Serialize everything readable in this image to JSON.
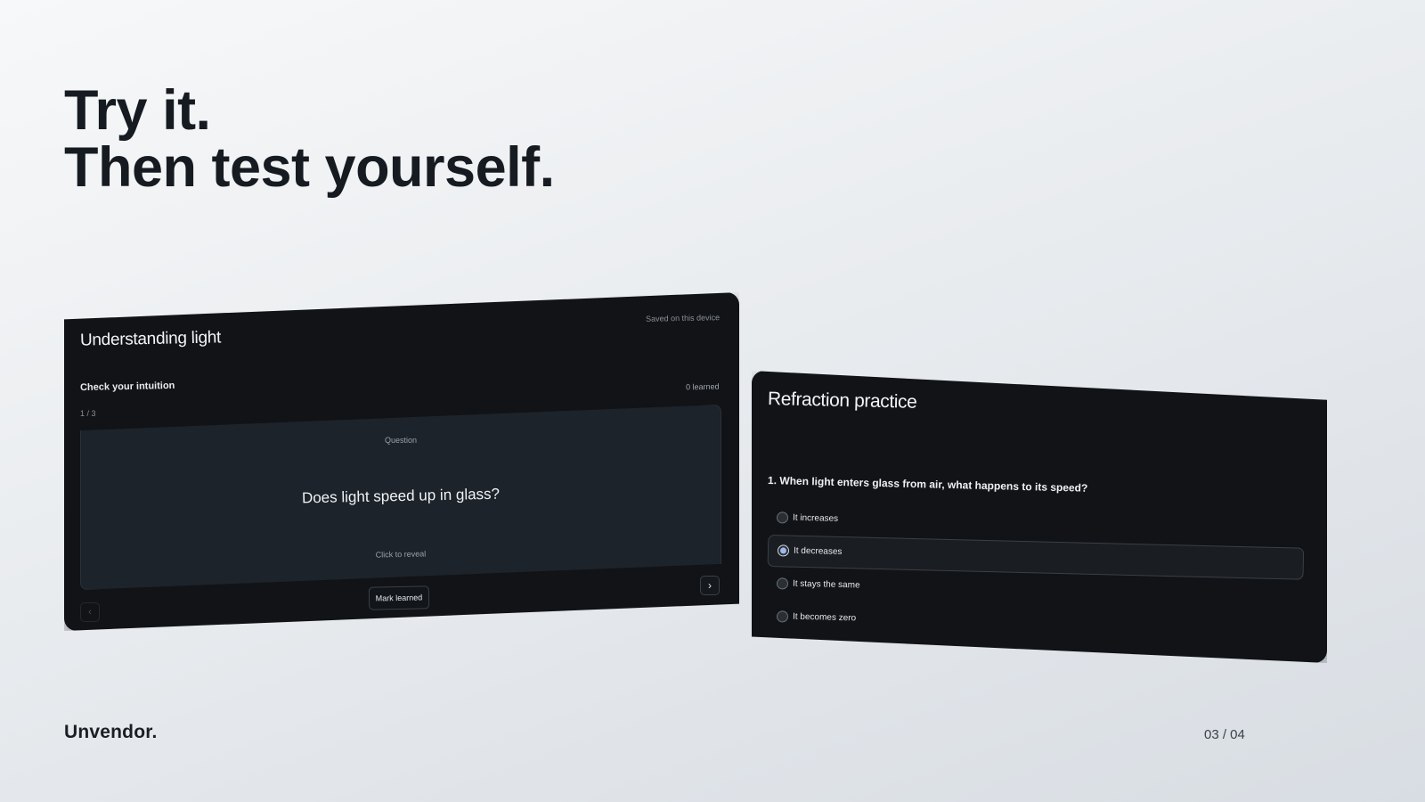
{
  "headline": {
    "line1": "Try it.",
    "line2": "Then test yourself."
  },
  "left_card": {
    "title": "Understanding light",
    "saved_status": "Saved on this device",
    "section_label": "Check your intuition",
    "learned_count": "0 learned",
    "position": "1 / 3",
    "flashcard": {
      "side_label": "Question",
      "text": "Does light speed up in glass?",
      "hint": "Click to reveal"
    },
    "mark_button": "Mark learned",
    "prev_icon": "chevron-left-icon",
    "next_icon": "chevron-right-icon"
  },
  "right_card": {
    "title": "Refraction practice",
    "question": "1. When light enters glass from air, what happens to its speed?",
    "options": [
      {
        "label": "It increases",
        "selected": false
      },
      {
        "label": "It decreases",
        "selected": true
      },
      {
        "label": "It stays the same",
        "selected": false
      },
      {
        "label": "It becomes zero",
        "selected": false
      }
    ]
  },
  "footer": {
    "brand": "Unvendor.",
    "pager": "03 / 04"
  },
  "colors": {
    "card_background": "#111316",
    "flashcard_background": "#1d232b",
    "selected_radio": "#9fb8e6",
    "headline": "#161b22"
  }
}
